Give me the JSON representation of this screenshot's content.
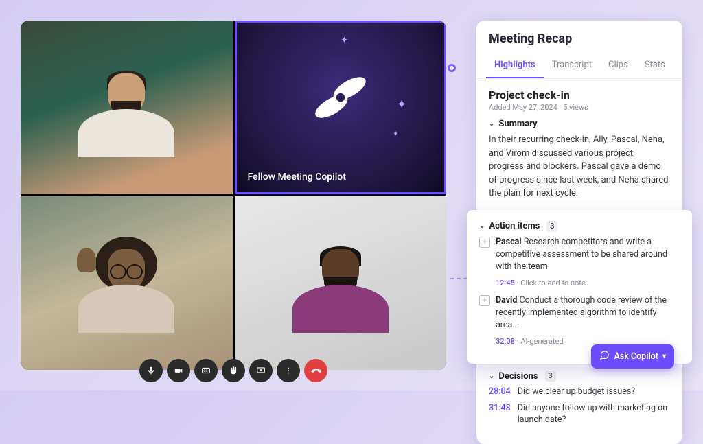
{
  "copilot_label": "Fellow Meeting Copilot",
  "recap": {
    "panel_title": "Meeting Recap",
    "tabs": [
      "Highlights",
      "Transcript",
      "Clips",
      "Stats"
    ],
    "active_tab_index": 0,
    "meeting_title": "Project check-in",
    "meeting_meta": "Added May 27, 2024 · 5 views",
    "summary": {
      "heading": "Summary",
      "text": "In their recurring check-in, Ally, Pascal, Neha, and Virom discussed various project progress and blockers. Pascal gave a demo of progress since last week, and Neha shared the plan for next cycle."
    },
    "action_items": {
      "heading": "Action items",
      "count": "3",
      "items": [
        {
          "assignee": "Pascal",
          "text": " Research competitors and write a competitive assessment to be shared around with the team",
          "timestamp": "12:45",
          "meta": "Click to add to note"
        },
        {
          "assignee": "David",
          "text": " Conduct a thorough code review of the recently implemented algorithm to identify area...",
          "timestamp": "32:08",
          "meta": "AI-generated"
        }
      ]
    },
    "decisions": {
      "heading": "Decisions",
      "count": "3",
      "items": [
        {
          "timestamp": "28:04",
          "text": "Did we clear up budget issues?"
        },
        {
          "timestamp": "31:48",
          "text": "Did anyone follow up with marketing on launch date?"
        }
      ]
    }
  },
  "ask_button": "Ask Copilot",
  "controls": {
    "mic": "microphone-icon",
    "cam": "camera-icon",
    "cc": "captions-icon",
    "hand": "raise-hand-icon",
    "share": "share-screen-icon",
    "more": "more-icon",
    "end": "end-call-icon"
  }
}
